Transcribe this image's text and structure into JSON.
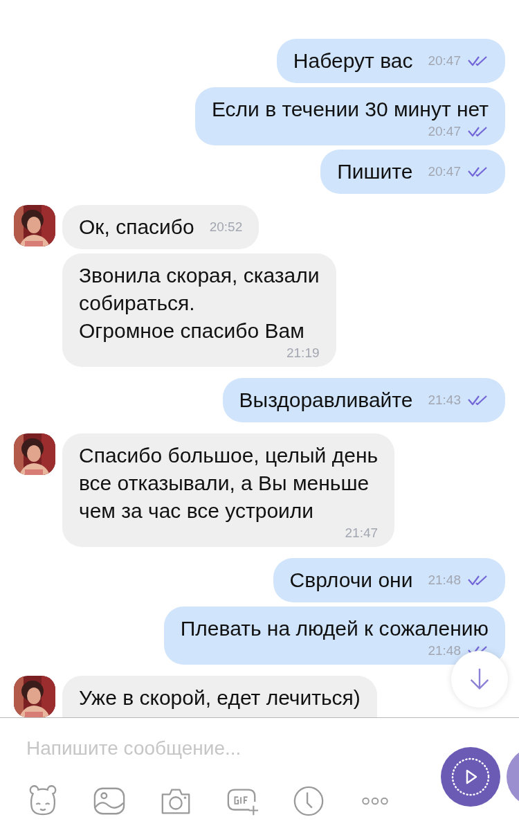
{
  "messages": [
    {
      "outgoing": true,
      "kind": "short",
      "text": "Наберут вас",
      "time": "20:47",
      "read": true
    },
    {
      "outgoing": true,
      "kind": "long",
      "text": "Если в течении 30 минут нет",
      "time": "20:47",
      "read": true
    },
    {
      "outgoing": true,
      "kind": "short",
      "text": "Пишите",
      "time": "20:47",
      "read": true
    },
    {
      "outgoing": false,
      "kind": "short",
      "avatar": true,
      "text": "Ок, спасибо",
      "time": "20:52"
    },
    {
      "outgoing": false,
      "kind": "long",
      "avatar": false,
      "text": "Звонила скорая, сказали\nсобираться.\nОгромное спасибо Вам",
      "time": "21:19"
    },
    {
      "outgoing": true,
      "kind": "short",
      "text": "Выздоравливайте",
      "time": "21:43",
      "read": true
    },
    {
      "outgoing": false,
      "kind": "long",
      "avatar": true,
      "text": "Спасибо большое, целый день\nвсе отказывали, а Вы меньше\nчем за час все устроили",
      "time": "21:47"
    },
    {
      "outgoing": true,
      "kind": "short",
      "text": "Сврлочи они",
      "time": "21:48",
      "read": true
    },
    {
      "outgoing": true,
      "kind": "long",
      "text": "Плевать на людей к сожалению",
      "time": "21:48",
      "read": true
    },
    {
      "outgoing": false,
      "kind": "cut",
      "avatar": true,
      "text": "Уже в скорой, едет лечиться)"
    }
  ],
  "composer": {
    "placeholder": "Напишите сообщение..."
  }
}
